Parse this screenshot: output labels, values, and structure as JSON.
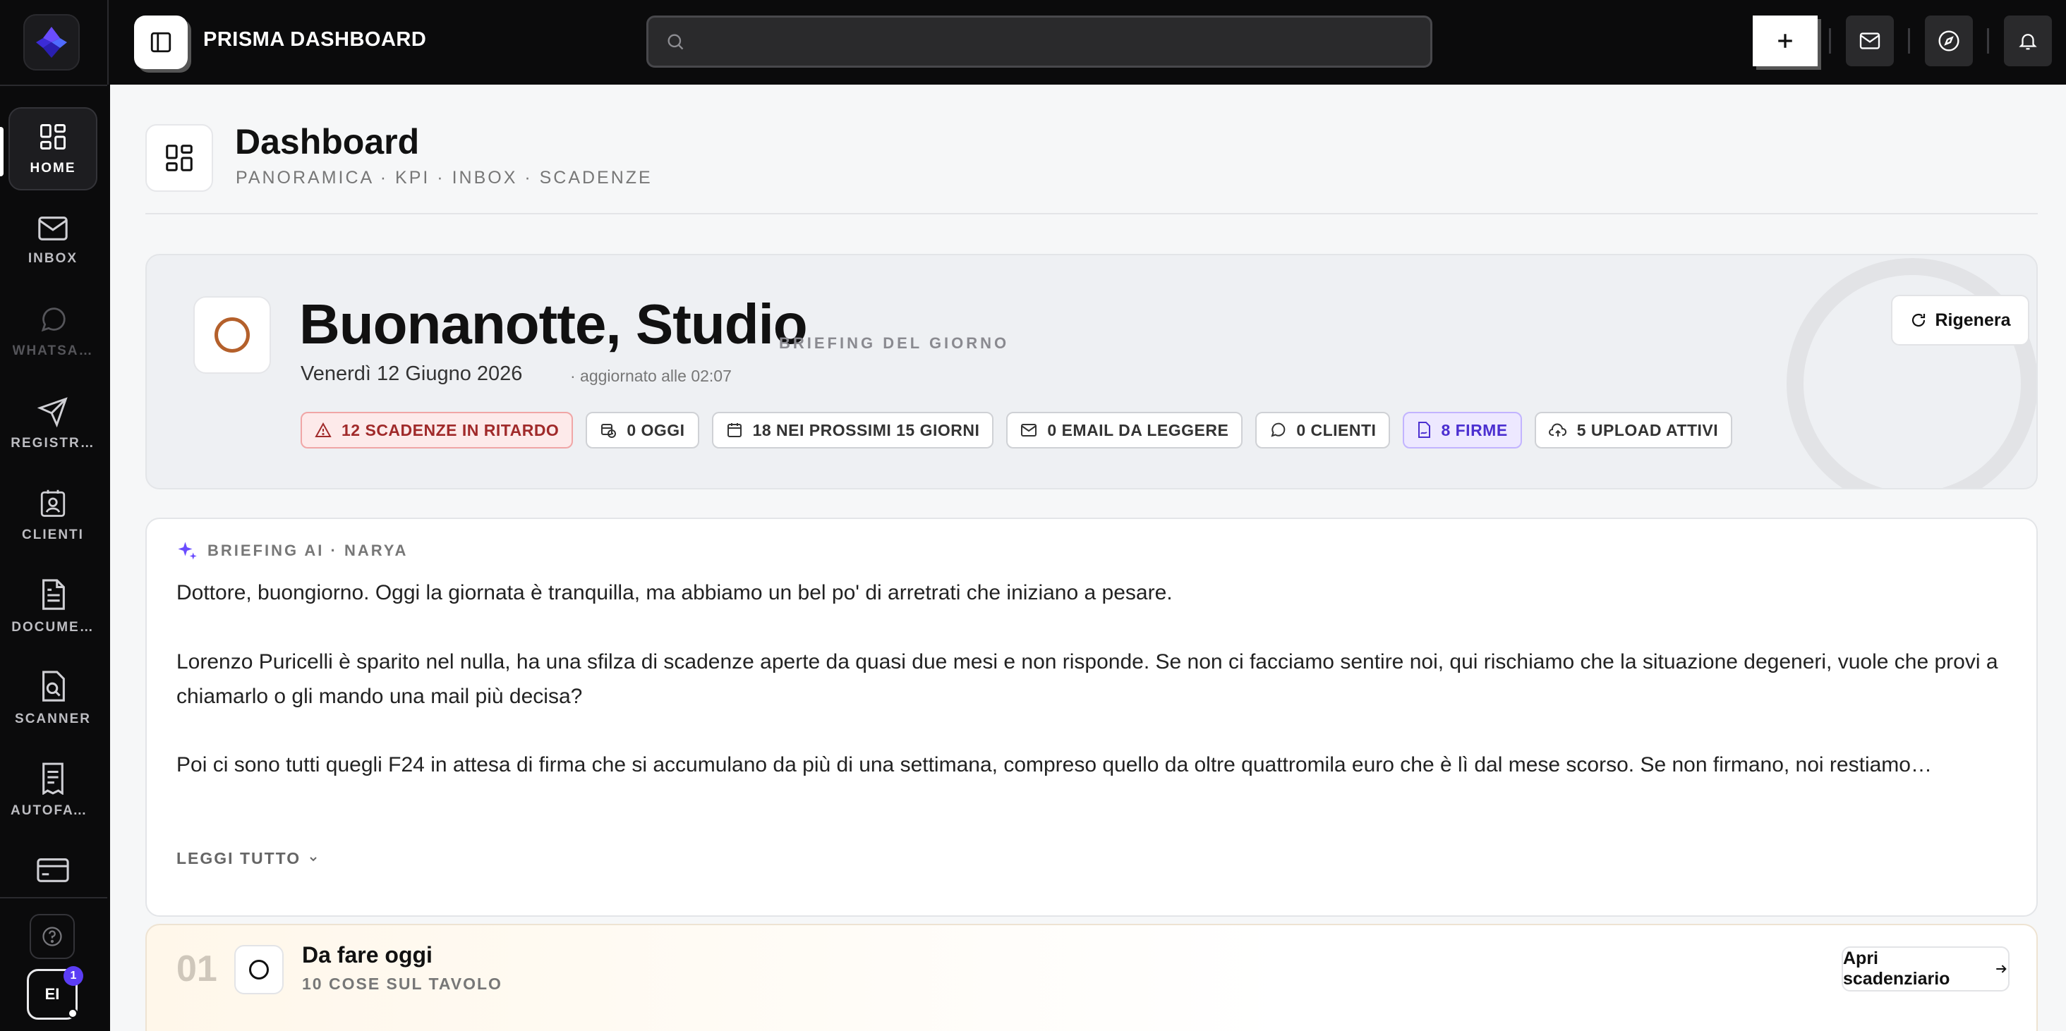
{
  "app": {
    "title": "PRISMA DASHBOARD"
  },
  "search": {
    "value": "",
    "placeholder": ""
  },
  "sidebar": {
    "items": [
      {
        "label": "HOME",
        "icon": "grid-icon",
        "active": true
      },
      {
        "label": "INBOX",
        "icon": "mail-icon"
      },
      {
        "label": "WHATSA…",
        "icon": "whatsapp-icon",
        "disabled": true
      },
      {
        "label": "REGISTR…",
        "icon": "send-icon"
      },
      {
        "label": "CLIENTI",
        "icon": "contact-icon"
      },
      {
        "label": "DOCUME…",
        "icon": "document-icon"
      },
      {
        "label": "SCANNER",
        "icon": "scanner-icon"
      },
      {
        "label": "AUTOFAT…",
        "icon": "receipt-icon"
      }
    ],
    "avatar_initials": "EI",
    "avatar_badge": "1"
  },
  "page": {
    "title": "Dashboard",
    "subtitle": "PANORAMICA · KPI · INBOX · SCADENZE"
  },
  "hero": {
    "greeting": "Buonanotte, Studio",
    "tag": "BRIEFING DEL GIORNO",
    "date": "Venerdì 12 Giugno 2026",
    "updated": "· aggiornato alle 02:07",
    "regen_label": "Rigenera",
    "chips": [
      {
        "label": "12 SCADENZE IN RITARDO",
        "tone": "red",
        "icon": "warning-icon"
      },
      {
        "label": "0 OGGI",
        "tone": "neutral",
        "icon": "calendar-clock-icon"
      },
      {
        "label": "18 NEI PROSSIMI 15 GIORNI",
        "tone": "neutral",
        "icon": "calendar-icon"
      },
      {
        "label": "0 EMAIL DA LEGGERE",
        "tone": "neutral",
        "icon": "mail-icon"
      },
      {
        "label": "0 CLIENTI",
        "tone": "neutral",
        "icon": "chat-icon"
      },
      {
        "label": "8 FIRME",
        "tone": "purple",
        "icon": "file-signature-icon"
      },
      {
        "label": "5 UPLOAD ATTIVI",
        "tone": "neutral",
        "icon": "cloud-upload-icon"
      }
    ]
  },
  "briefing": {
    "tag": "BRIEFING AI · NARYA",
    "p1": "Dottore, buongiorno. Oggi la giornata è tranquilla, ma abbiamo un bel po' di arretrati che iniziano a pesare.",
    "p2": "Lorenzo Puricelli è sparito nel nulla, ha una sfilza di scadenze aperte da quasi due mesi e non risponde. Se non ci facciamo sentire noi, qui rischiamo che la situazione degeneri, vuole che provi a chiamarlo o gli mando una mail più decisa?",
    "p3": "Poi ci sono tutti quegli F24 in attesa di firma che si accumulano da più di una settimana, compreso quello da oltre quattromila euro che è lì dal mese scorso. Se non firmano, noi restiamo…",
    "read_more": "LEGGI TUTTO"
  },
  "todo": {
    "number": "01",
    "title": "Da fare oggi",
    "subtitle": "10 COSE SUL TAVOLO",
    "button": "Apri scadenziario"
  }
}
